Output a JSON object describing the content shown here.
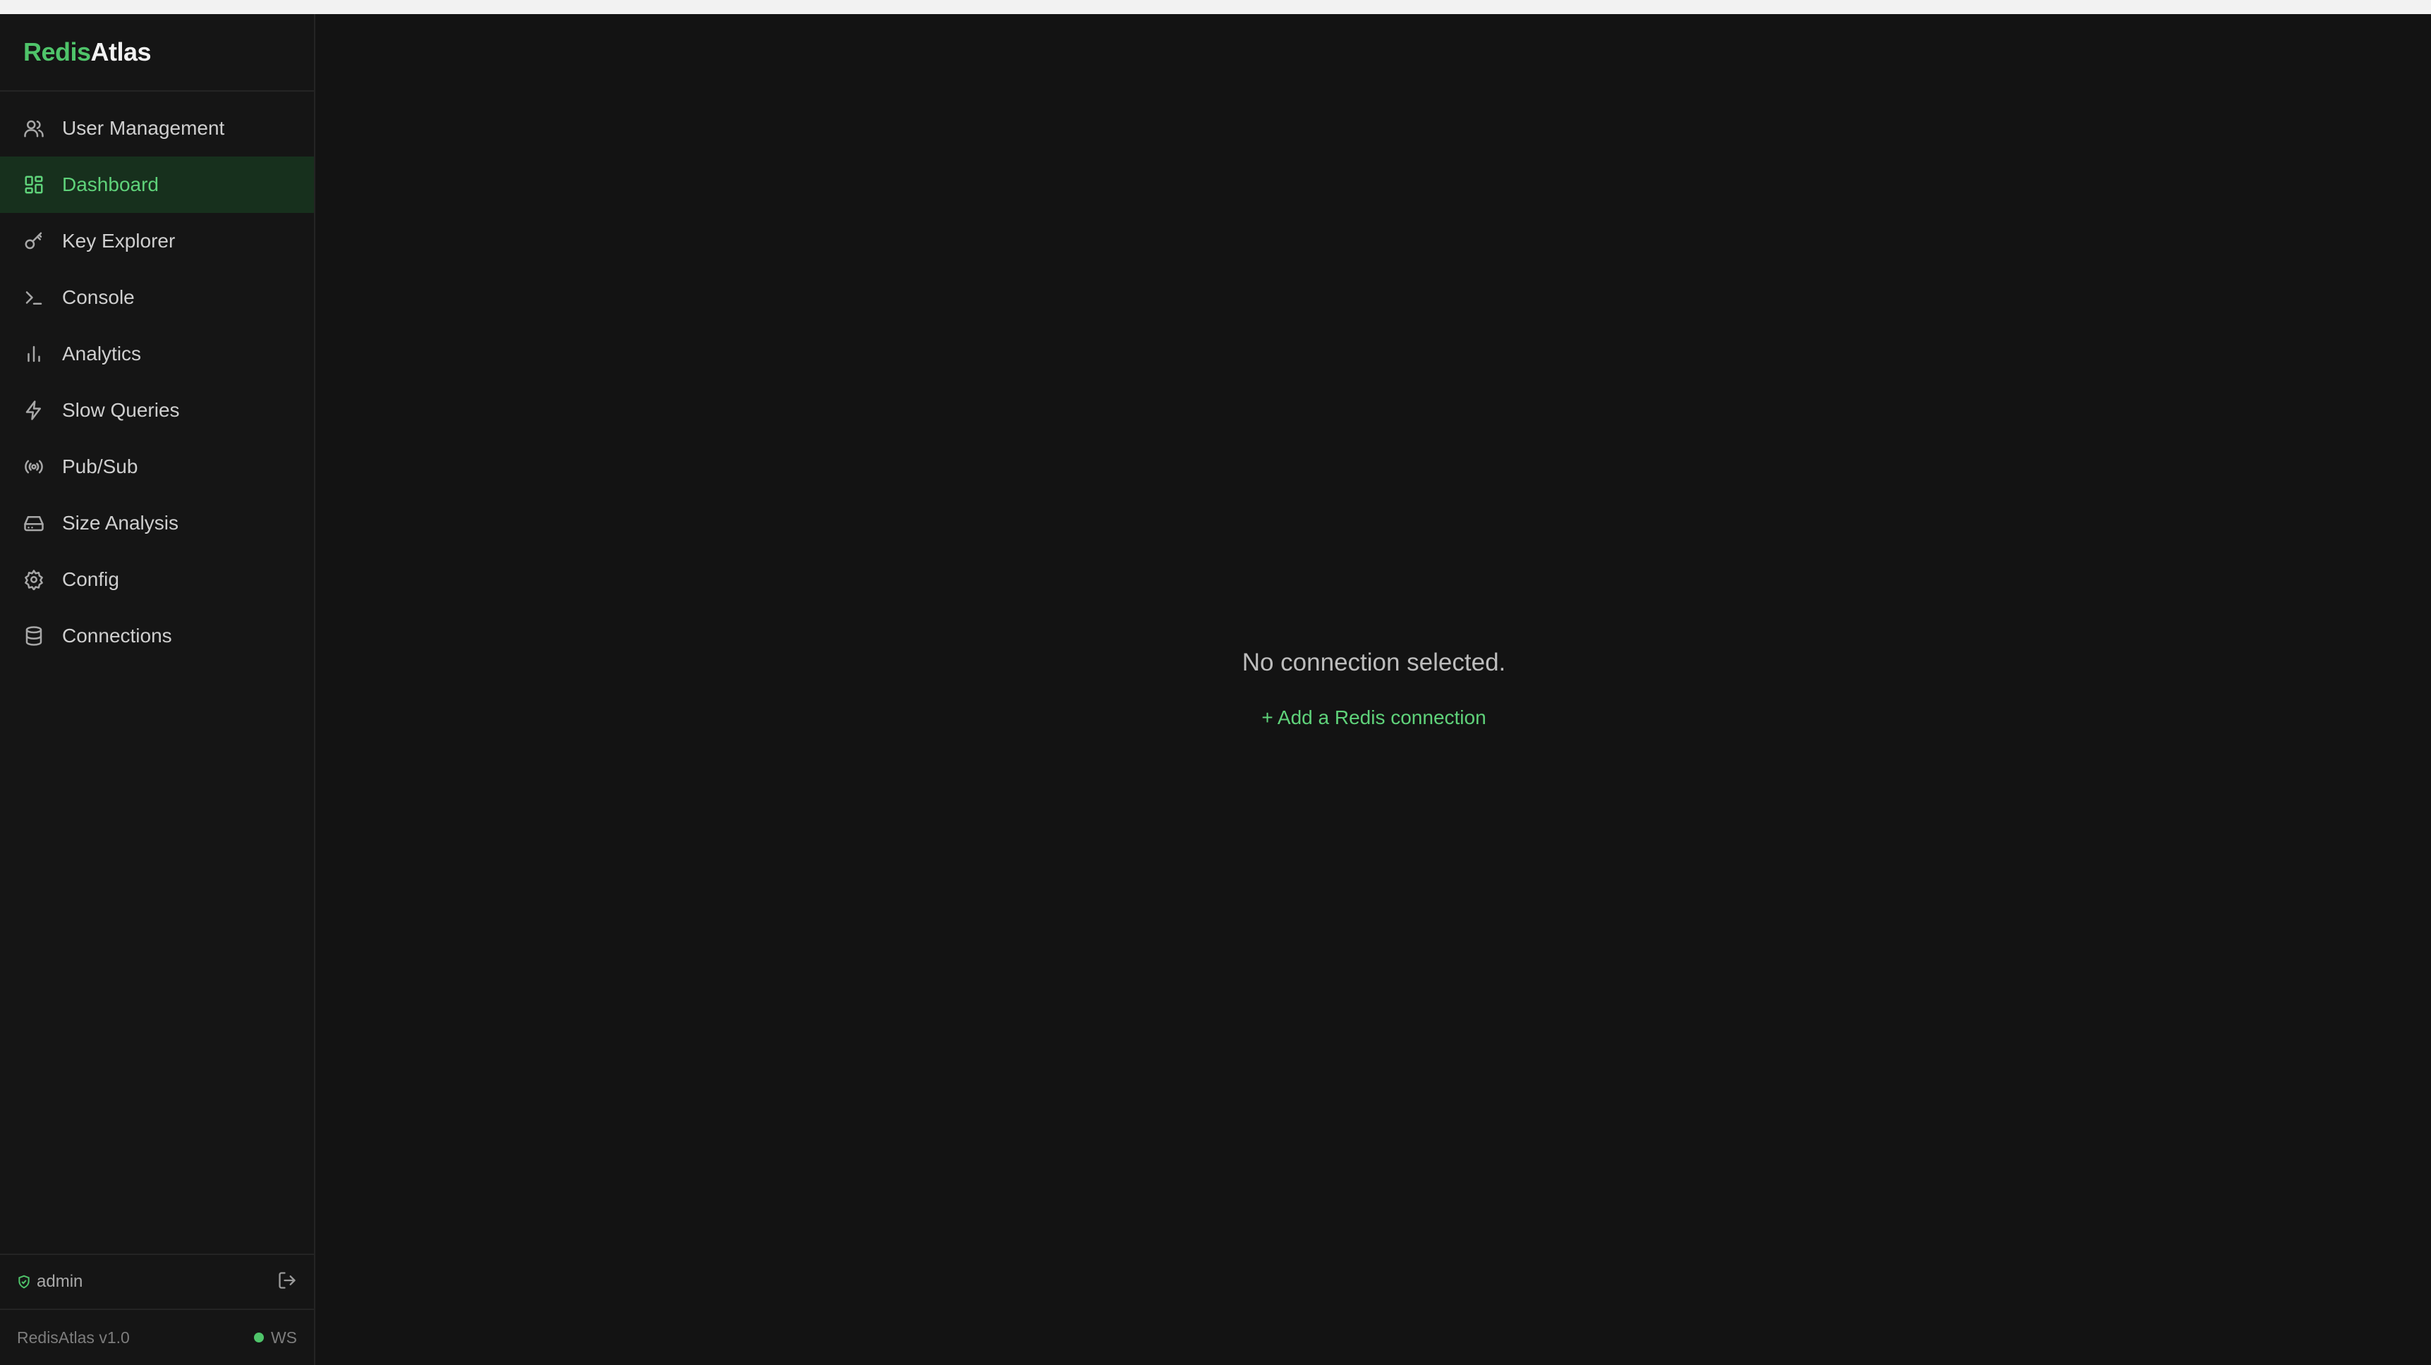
{
  "brand": {
    "part1": "Redis",
    "part2": "Atlas"
  },
  "sidebar": {
    "items": [
      {
        "label": "User Management",
        "icon": "users-icon"
      },
      {
        "label": "Dashboard",
        "icon": "grid-icon",
        "active": true
      },
      {
        "label": "Key Explorer",
        "icon": "key-icon"
      },
      {
        "label": "Console",
        "icon": "terminal-icon"
      },
      {
        "label": "Analytics",
        "icon": "bar-chart-icon"
      },
      {
        "label": "Slow Queries",
        "icon": "bolt-icon"
      },
      {
        "label": "Pub/Sub",
        "icon": "broadcast-icon"
      },
      {
        "label": "Size Analysis",
        "icon": "hard-drive-icon"
      },
      {
        "label": "Config",
        "icon": "gear-icon"
      },
      {
        "label": "Connections",
        "icon": "database-icon"
      }
    ]
  },
  "footer": {
    "user": "admin",
    "version": "RedisAtlas v1.0",
    "ws_label": "WS"
  },
  "main": {
    "empty_message": "No connection selected.",
    "add_link": "+ Add a Redis connection"
  },
  "colors": {
    "accent": "#4fc46a",
    "active_bg": "#17301d",
    "background": "#131313"
  }
}
